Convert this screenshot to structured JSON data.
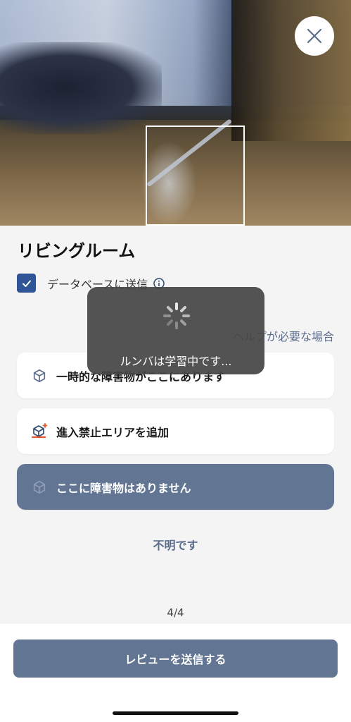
{
  "room": {
    "title": "リビングルーム"
  },
  "database": {
    "label": "データベースに送信",
    "checked": true
  },
  "help": {
    "label": "ヘルプが必要な場合"
  },
  "options": [
    {
      "label": "一時的な障害物がここにあります",
      "icon": "cube-icon",
      "selected": false
    },
    {
      "label": "進入禁止エリアを追加",
      "icon": "keep-out-zone-icon",
      "selected": false
    },
    {
      "label": "ここに障害物はありません",
      "icon": "cube-icon",
      "selected": true
    }
  ],
  "unknown": {
    "label": "不明です"
  },
  "pagination": {
    "text": "4/4"
  },
  "submit": {
    "label": "レビューを送信する"
  },
  "toast": {
    "text": "ルンバは学習中です..."
  },
  "colors": {
    "accent": "#627694",
    "checkbox": "#2f5597",
    "link": "#5a6d8c",
    "toast_bg": "#464646"
  }
}
